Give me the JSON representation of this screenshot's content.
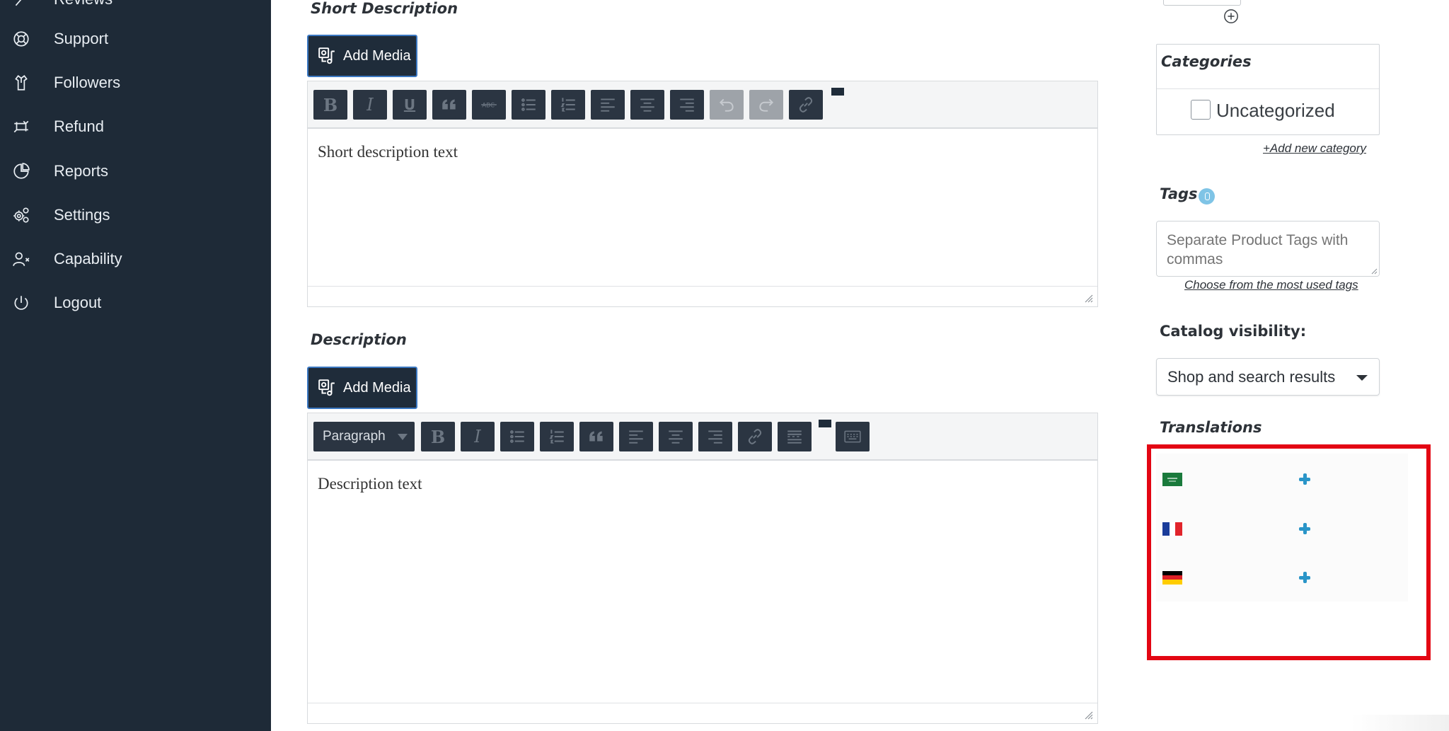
{
  "sidebar": {
    "items": [
      {
        "label": "Reviews",
        "icon": "review-icon"
      },
      {
        "label": "Support",
        "icon": "lifebuoy-icon"
      },
      {
        "label": "Followers",
        "icon": "followers-icon"
      },
      {
        "label": "Refund",
        "icon": "refund-icon"
      },
      {
        "label": "Reports",
        "icon": "pie-chart-icon"
      },
      {
        "label": "Settings",
        "icon": "gears-icon"
      },
      {
        "label": "Capability",
        "icon": "user-x-icon"
      },
      {
        "label": "Logout",
        "icon": "power-icon"
      }
    ]
  },
  "short_description": {
    "title": "Short Description",
    "add_media_label": "Add Media",
    "content": "Short description text",
    "toolbar": [
      "bold",
      "italic",
      "underline",
      "blockquote",
      "strikethrough",
      "bulleted-list",
      "numbered-list",
      "align-left",
      "align-center",
      "align-right",
      "undo",
      "redo",
      "link"
    ]
  },
  "description": {
    "title": "Description",
    "add_media_label": "Add Media",
    "format_select": "Paragraph",
    "content": "Description text",
    "toolbar": [
      "bold",
      "italic",
      "bulleted-list",
      "numbered-list",
      "blockquote",
      "align-left",
      "align-center",
      "align-right",
      "link",
      "read-more",
      "toolbar-toggle"
    ]
  },
  "categories": {
    "title": "Categories",
    "items": [
      {
        "label": "Uncategorized",
        "checked": false
      }
    ],
    "add_new_label": "+Add new category"
  },
  "tags": {
    "title": "Tags",
    "placeholder": "Separate Product Tags with commas",
    "most_used_label": "Choose from the most used tags"
  },
  "catalog_visibility": {
    "title": "Catalog visibility:",
    "selected": "Shop and search results"
  },
  "translations": {
    "title": "Translations",
    "languages": [
      {
        "flag": "saudi-arabia-flag-icon",
        "action": "add-translation-icon"
      },
      {
        "flag": "france-flag-icon",
        "action": "add-translation-icon"
      },
      {
        "flag": "germany-flag-icon",
        "action": "add-translation-icon"
      }
    ]
  },
  "colors": {
    "sidebar_bg": "#1e2a37",
    "highlight": "#e30613",
    "accent_blue": "#2a95c8",
    "button_bg": "#1f2c3a"
  }
}
